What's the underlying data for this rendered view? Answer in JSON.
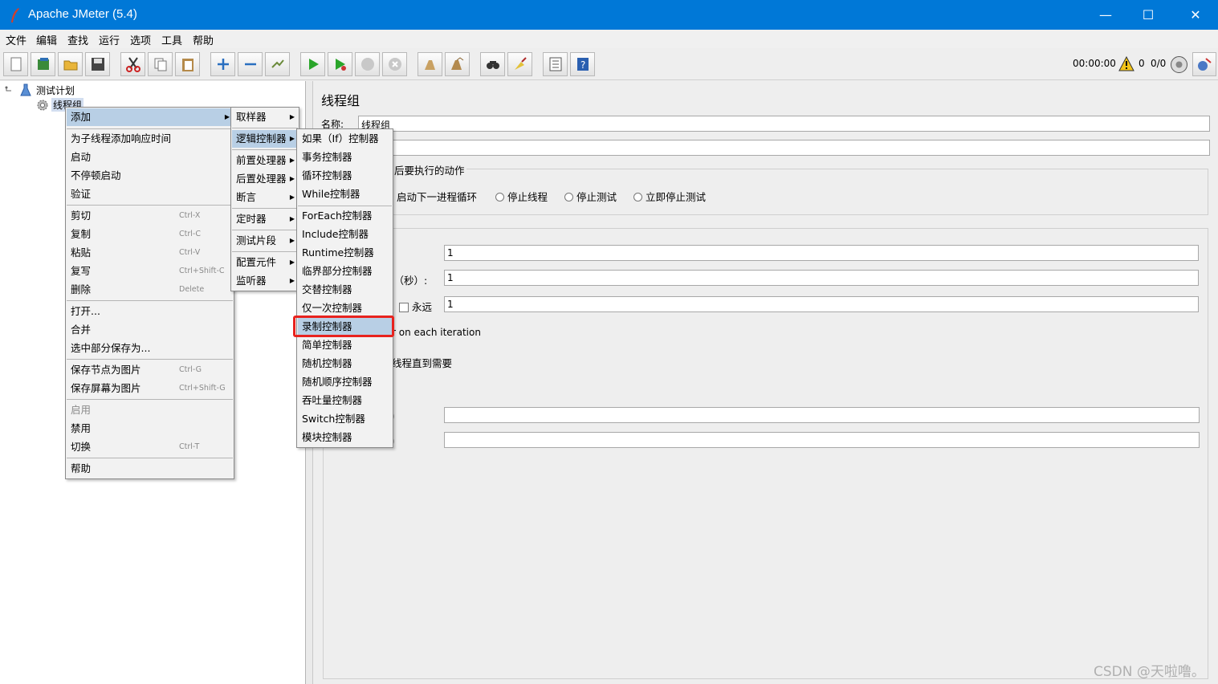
{
  "window": {
    "title": "Apache JMeter (5.4)",
    "minimize": "—",
    "maximize": "☐",
    "close": "✕"
  },
  "menubar": [
    "文件",
    "编辑",
    "查找",
    "运行",
    "选项",
    "工具",
    "帮助"
  ],
  "toolbar": {
    "timer": "00:00:00",
    "warning_count": "0",
    "threads": "0/0"
  },
  "tree": {
    "root": "测试计划",
    "child": "线程组"
  },
  "panel": {
    "title": "线程组",
    "name_label": "名称:",
    "name_value": "线程组",
    "action_label": "后要执行的动作",
    "radio_options": [
      "启动下一进程循环",
      "停止线程",
      "停止测试",
      "立即停止测试"
    ],
    "field1_value": "1",
    "ramp_label": "间（秒）:",
    "field2_value": "1",
    "forever_label": "永远",
    "field3_value": "1",
    "iteration_text": "r on each iteration",
    "delay_text": "线程直到需要",
    "paren1": "）",
    "paren2": "）"
  },
  "context_menu": {
    "items": [
      {
        "label": "添加",
        "shortcut": "",
        "submenu": true
      },
      {
        "label": "为子线程添加响应时间",
        "shortcut": ""
      },
      {
        "label": "启动",
        "shortcut": ""
      },
      {
        "label": "不停顿启动",
        "shortcut": ""
      },
      {
        "label": "验证",
        "shortcut": ""
      },
      {
        "label": "剪切",
        "shortcut": "Ctrl-X"
      },
      {
        "label": "复制",
        "shortcut": "Ctrl-C"
      },
      {
        "label": "粘贴",
        "shortcut": "Ctrl-V"
      },
      {
        "label": "复写",
        "shortcut": "Ctrl+Shift-C"
      },
      {
        "label": "删除",
        "shortcut": "Delete"
      },
      {
        "label": "打开...",
        "shortcut": ""
      },
      {
        "label": "合并",
        "shortcut": ""
      },
      {
        "label": "选中部分保存为...",
        "shortcut": ""
      },
      {
        "label": "保存节点为图片",
        "shortcut": "Ctrl-G"
      },
      {
        "label": "保存屏幕为图片",
        "shortcut": "Ctrl+Shift-G"
      },
      {
        "label": "启用",
        "shortcut": ""
      },
      {
        "label": "禁用",
        "shortcut": ""
      },
      {
        "label": "切换",
        "shortcut": "Ctrl-T"
      },
      {
        "label": "帮助",
        "shortcut": ""
      }
    ]
  },
  "add_submenu": {
    "items": [
      "取样器",
      "逻辑控制器",
      "前置处理器",
      "后置处理器",
      "断言",
      "定时器",
      "测试片段",
      "配置元件",
      "监听器"
    ]
  },
  "logic_submenu": {
    "items": [
      "如果（If）控制器",
      "事务控制器",
      "循环控制器",
      "While控制器",
      "ForEach控制器",
      "Include控制器",
      "Runtime控制器",
      "临界部分控制器",
      "交替控制器",
      "仅一次控制器",
      "录制控制器",
      "简单控制器",
      "随机控制器",
      "随机顺序控制器",
      "吞吐量控制器",
      "Switch控制器",
      "模块控制器"
    ]
  },
  "watermark": "CSDN @天啦噜。",
  "colors": {
    "titlebar": "#0078d7",
    "selection": "#b8cfe5",
    "highlight_box": "#e8231e"
  }
}
